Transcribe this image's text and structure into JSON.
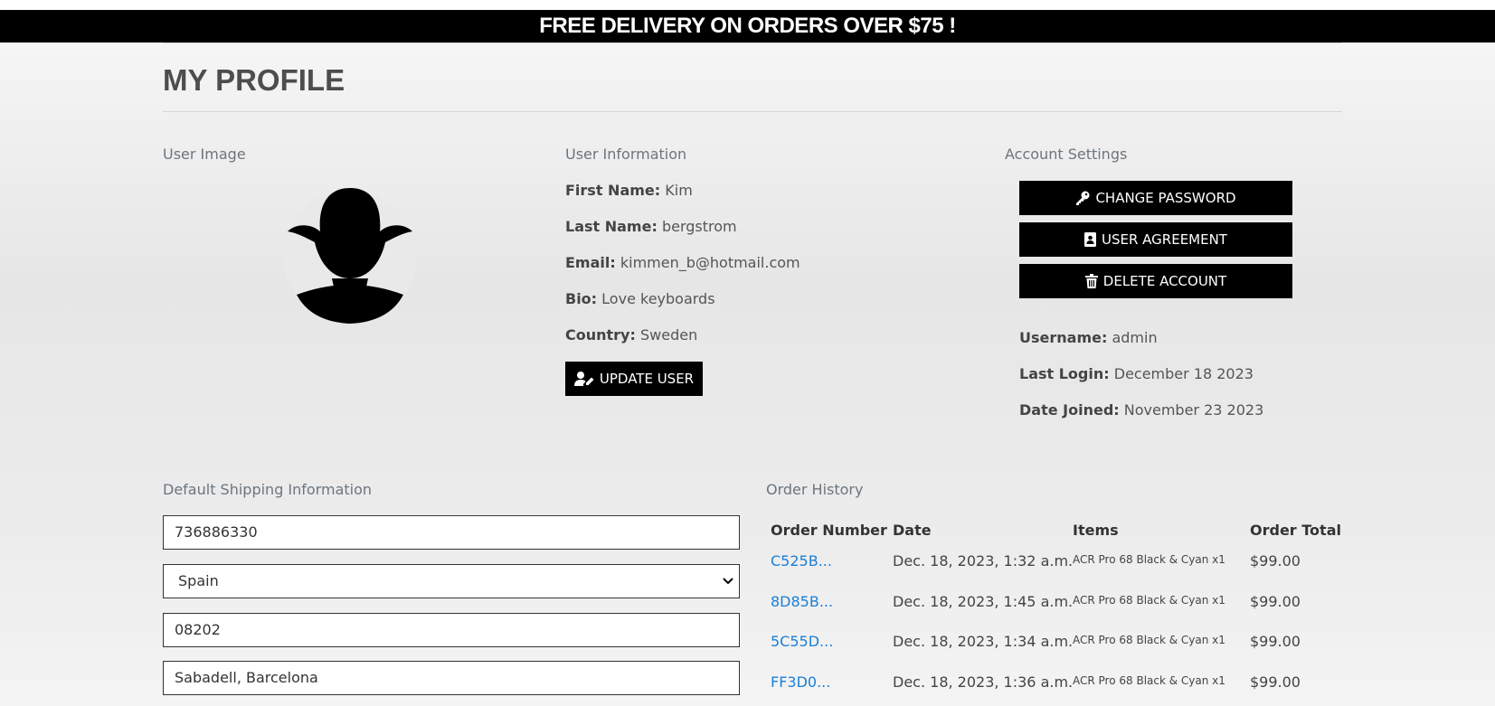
{
  "banner": {
    "text": "FREE DELIVERY ON ORDERS OVER $75 !"
  },
  "page_title": "MY PROFILE",
  "user_image": {
    "label": "User Image"
  },
  "user_info": {
    "label": "User Information",
    "first_name_label": "First Name:",
    "first_name": "Kim",
    "last_name_label": "Last Name:",
    "last_name": "bergstrom",
    "email_label": "Email:",
    "email": "kimmen_b@hotmail.com",
    "bio_label": "Bio:",
    "bio": "Love keyboards",
    "country_label": "Country:",
    "country": "Sweden",
    "update_button": "UPDATE USER"
  },
  "account": {
    "label": "Account Settings",
    "change_password": "CHANGE PASSWORD",
    "user_agreement": "USER AGREEMENT",
    "delete_account": "DELETE ACCOUNT",
    "username_label": "Username:",
    "username": "admin",
    "last_login_label": "Last Login:",
    "last_login": "December 18 2023",
    "date_joined_label": "Date Joined:",
    "date_joined": "November 23 2023"
  },
  "shipping": {
    "label": "Default Shipping Information",
    "phone": "736886330",
    "country": "Spain",
    "postcode": "08202",
    "city": "Sabadell, Barcelona"
  },
  "orders": {
    "label": "Order History",
    "headers": [
      "Order Number",
      "Date",
      "Items",
      "Order Total"
    ],
    "rows": [
      {
        "number": "C525B...",
        "date": "Dec. 18, 2023, 1:32 a.m.",
        "items": "ACR Pro 68 Black & Cyan x1",
        "total": "$99.00"
      },
      {
        "number": "8D85B...",
        "date": "Dec. 18, 2023, 1:45 a.m.",
        "items": "ACR Pro 68 Black & Cyan x1",
        "total": "$99.00"
      },
      {
        "number": "5C55D...",
        "date": "Dec. 18, 2023, 1:34 a.m.",
        "items": "ACR Pro 68 Black & Cyan x1",
        "total": "$99.00"
      },
      {
        "number": "FF3D0...",
        "date": "Dec. 18, 2023, 1:36 a.m.",
        "items": "ACR Pro 68 Black & Cyan x1",
        "total": "$99.00"
      }
    ]
  },
  "colors": {
    "banner_bg": "#000000",
    "link": "#1a7fd8",
    "button_bg": "#000000"
  },
  "icons": [
    "key-icon",
    "id-card-icon",
    "trash-icon",
    "user-pen-icon",
    "chevron-down-icon",
    "avatar-silhouette"
  ]
}
